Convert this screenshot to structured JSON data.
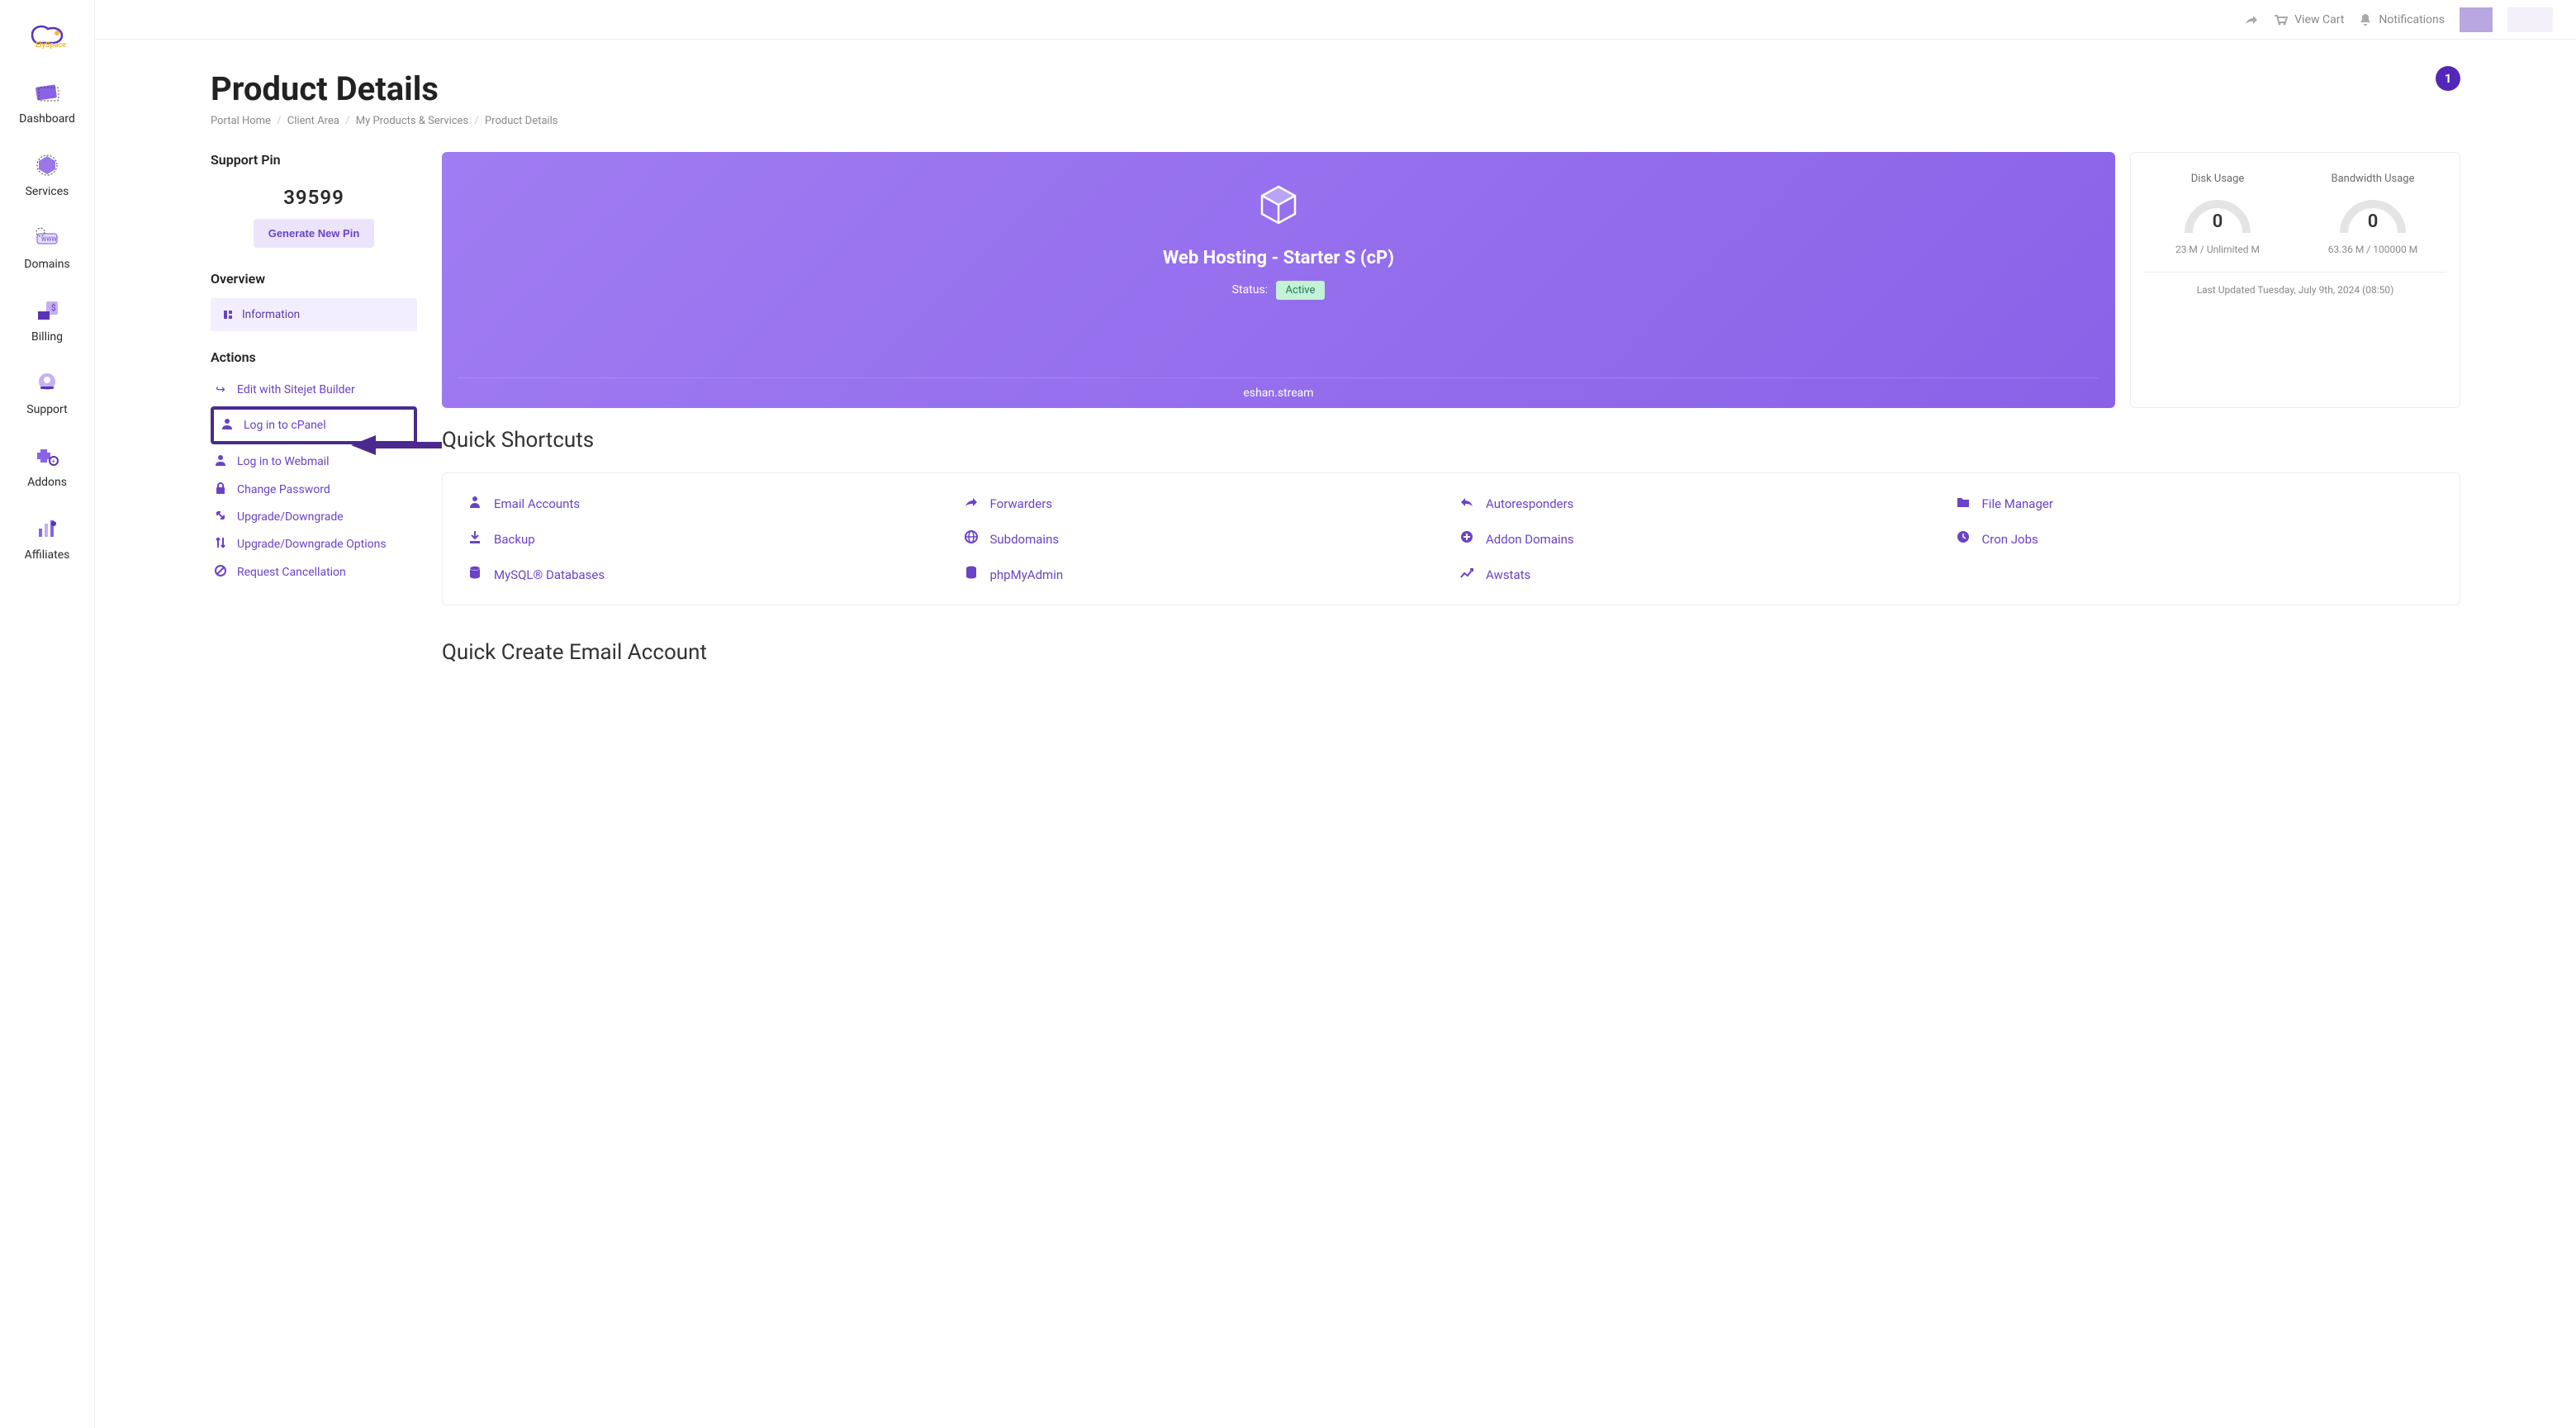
{
  "brand": "ElySpace",
  "sidebar": {
    "items": [
      {
        "label": "Dashboard"
      },
      {
        "label": "Services"
      },
      {
        "label": "Domains"
      },
      {
        "label": "Billing"
      },
      {
        "label": "Support"
      },
      {
        "label": "Addons"
      },
      {
        "label": "Affiliates"
      }
    ]
  },
  "topbar": {
    "view_cart": "View Cart",
    "notifications": "Notifications"
  },
  "page": {
    "title": "Product Details",
    "breadcrumb": [
      "Portal Home",
      "Client Area",
      "My Products & Services",
      "Product Details"
    ],
    "notif_count": "1"
  },
  "support_pin": {
    "heading": "Support Pin",
    "value": "39599",
    "button": "Generate New Pin"
  },
  "overview": {
    "heading": "Overview",
    "info_label": "Information"
  },
  "actions": {
    "heading": "Actions",
    "items": [
      {
        "label": "Edit with Sitejet Builder"
      },
      {
        "label": "Log in to cPanel",
        "highlight": true
      },
      {
        "label": "Log in to Webmail"
      },
      {
        "label": "Change Password"
      },
      {
        "label": "Upgrade/Downgrade"
      },
      {
        "label": "Upgrade/Downgrade Options"
      },
      {
        "label": "Request Cancellation"
      }
    ]
  },
  "product": {
    "name": "Web Hosting - Starter S (cP)",
    "status_label": "Status:",
    "status_value": "Active",
    "domain": "eshan.stream"
  },
  "usage": {
    "disk": {
      "title": "Disk Usage",
      "value": "0",
      "sub": "23 M / Unlimited M"
    },
    "bw": {
      "title": "Bandwidth Usage",
      "value": "0",
      "sub": "63.36 M / 100000 M"
    },
    "footer": "Last Updated Tuesday, July 9th, 2024 (08:50)"
  },
  "shortcuts": {
    "heading": "Quick Shortcuts",
    "items": [
      {
        "label": "Email Accounts"
      },
      {
        "label": "Forwarders"
      },
      {
        "label": "Autoresponders"
      },
      {
        "label": "File Manager"
      },
      {
        "label": "Backup"
      },
      {
        "label": "Subdomains"
      },
      {
        "label": "Addon Domains"
      },
      {
        "label": "Cron Jobs"
      },
      {
        "label": "MySQL® Databases"
      },
      {
        "label": "phpMyAdmin"
      },
      {
        "label": "Awstats"
      }
    ]
  },
  "email": {
    "heading": "Quick Create Email Account"
  }
}
